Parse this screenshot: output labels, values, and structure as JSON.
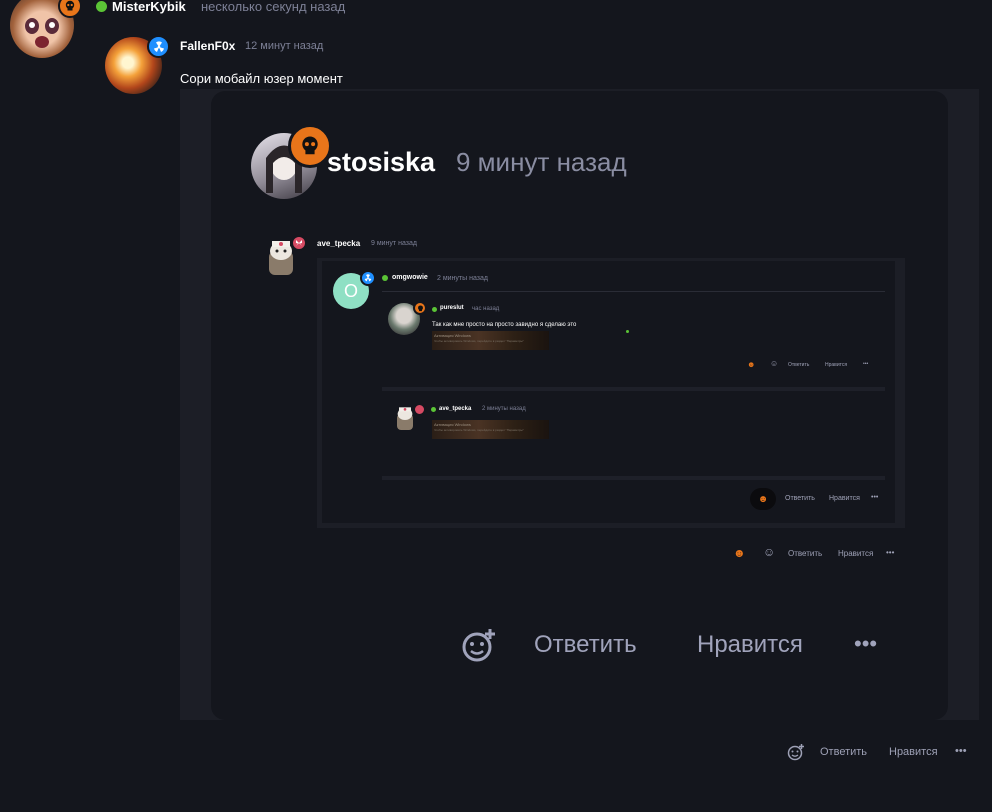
{
  "top": {
    "username": "MisterKybik",
    "time": "несколько секунд назад"
  },
  "reply": {
    "username": "FallenF0x",
    "time": "12 минут назад",
    "text": "Сори мобайл юзер момент"
  },
  "shot": {
    "username": "stosiska",
    "time": "9 минут назад",
    "ave1": {
      "username": "ave_tpecka",
      "time": "9 минут назад"
    },
    "omg": {
      "avatar_letter": "O",
      "username": "omgwowie",
      "time": "2 минуты назад"
    },
    "pure": {
      "username": "pureslut",
      "time": "час назад",
      "text": "Так как мне просто на просто завидно я сделаю это",
      "win_line1": "Активация Windows",
      "win_line2": "Чтобы активировать Windows, перейдите в раздел \"Параметры\""
    },
    "ave2": {
      "username": "ave_tpecka",
      "time": "2 минуты назад",
      "win_line1": "Активация Windows",
      "win_line2": "Чтобы активировать Windows, перейдите в раздел \"Параметры\""
    },
    "actions": {
      "reply": "Ответить",
      "like": "Нравится",
      "more": "•••"
    }
  },
  "bottom_actions": {
    "reply": "Ответить",
    "like": "Нравится",
    "more": "•••"
  },
  "colors": {
    "background": "#14161d",
    "card": "#1a1c24",
    "skull_badge": "#e8751a",
    "blue_badge": "#1f8fff",
    "red_badge": "#d64a63",
    "online": "#5bc436",
    "muted_text": "#9ea1b6"
  },
  "icons": [
    "skull-icon",
    "radiation-icon",
    "butterfly-icon",
    "add-reaction-icon",
    "emoji-reaction-icon",
    "more-dots-icon"
  ]
}
